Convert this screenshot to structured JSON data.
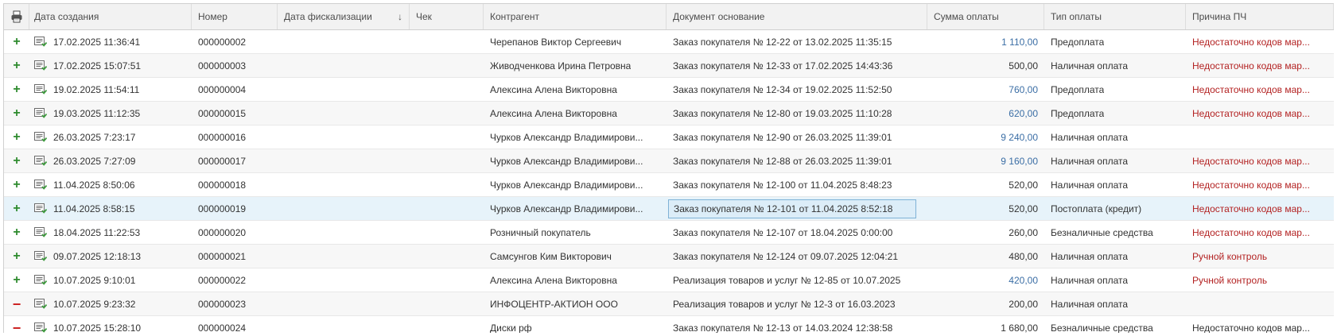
{
  "columns": {
    "icon": "printer-icon",
    "created": "Дата создания",
    "number": "Номер",
    "fiscal_date": "Дата фискализации",
    "fiscal_sort": "↓",
    "receipt": "Чек",
    "counterparty": "Контрагент",
    "basis": "Документ основание",
    "amount": "Сумма оплаты",
    "pay_type": "Тип оплаты",
    "reason": "Причина ПЧ"
  },
  "rows": [
    {
      "sign": "+",
      "created": "17.02.2025 11:36:41",
      "number": "000000002",
      "fiscal_date": "",
      "receipt": "",
      "counterparty": "Черепанов Виктор Сергеевич",
      "basis": "Заказ покупателя № 12-22 от 13.02.2025 11:35:15",
      "amount": "1 110,00",
      "pay_type": "Предоплата",
      "reason": "Недостаточно кодов мар..."
    },
    {
      "sign": "+",
      "created": "17.02.2025 15:07:51",
      "number": "000000003",
      "fiscal_date": "",
      "receipt": "",
      "counterparty": "Живодченкова Ирина Петровна",
      "basis": "Заказ покупателя № 12-33 от 17.02.2025 14:43:36",
      "amount": "500,00",
      "pay_type": "Наличная оплата",
      "reason": "Недостаточно кодов мар..."
    },
    {
      "sign": "+",
      "created": "19.02.2025 11:54:11",
      "number": "000000004",
      "fiscal_date": "",
      "receipt": "",
      "counterparty": "Алексина Алена Викторовна",
      "basis": "Заказ покупателя № 12-34 от 19.02.2025 11:52:50",
      "amount": "760,00",
      "pay_type": "Предоплата",
      "reason": "Недостаточно кодов мар..."
    },
    {
      "sign": "+",
      "created": "19.03.2025 11:12:35",
      "number": "000000015",
      "fiscal_date": "",
      "receipt": "",
      "counterparty": "Алексина Алена Викторовна",
      "basis": "Заказ покупателя № 12-80 от 19.03.2025 11:10:28",
      "amount": "620,00",
      "pay_type": "Предоплата",
      "reason": "Недостаточно кодов мар..."
    },
    {
      "sign": "+",
      "created": "26.03.2025 7:23:17",
      "number": "000000016",
      "fiscal_date": "",
      "receipt": "",
      "counterparty": "Чурков Александр Владимирови...",
      "basis": "Заказ покупателя № 12-90 от 26.03.2025 11:39:01",
      "amount": "9 240,00",
      "pay_type": "Наличная оплата",
      "reason": ""
    },
    {
      "sign": "+",
      "created": "26.03.2025 7:27:09",
      "number": "000000017",
      "fiscal_date": "",
      "receipt": "",
      "counterparty": "Чурков Александр Владимирови...",
      "basis": "Заказ покупателя № 12-88 от 26.03.2025 11:39:01",
      "amount": "9 160,00",
      "pay_type": "Наличная оплата",
      "reason": "Недостаточно кодов мар..."
    },
    {
      "sign": "+",
      "created": "11.04.2025 8:50:06",
      "number": "000000018",
      "fiscal_date": "",
      "receipt": "",
      "counterparty": "Чурков Александр Владимирови...",
      "basis": "Заказ покупателя № 12-100 от 11.04.2025 8:48:23",
      "amount": "520,00",
      "pay_type": "Наличная оплата",
      "reason": "Недостаточно кодов мар..."
    },
    {
      "sign": "+",
      "created": "11.04.2025 8:58:15",
      "number": "000000019",
      "fiscal_date": "",
      "receipt": "",
      "counterparty": "Чурков Александр Владимирови...",
      "basis": "Заказ покупателя № 12-101 от 11.04.2025 8:52:18",
      "amount": "520,00",
      "pay_type": "Постоплата (кредит)",
      "reason": "Недостаточно кодов мар..."
    },
    {
      "sign": "+",
      "created": "18.04.2025 11:22:53",
      "number": "000000020",
      "fiscal_date": "",
      "receipt": "",
      "counterparty": "Розничный покупатель",
      "basis": "Заказ покупателя № 12-107 от 18.04.2025 0:00:00",
      "amount": "260,00",
      "pay_type": "Безналичные средства",
      "reason": "Недостаточно кодов мар..."
    },
    {
      "sign": "+",
      "created": "09.07.2025 12:18:13",
      "number": "000000021",
      "fiscal_date": "",
      "receipt": "",
      "counterparty": "Самсунгов Ким Викторович",
      "basis": "Заказ покупателя № 12-124 от 09.07.2025 12:04:21",
      "amount": "480,00",
      "pay_type": "Наличная оплата",
      "reason": "Ручной контроль"
    },
    {
      "sign": "+",
      "created": "10.07.2025 9:10:01",
      "number": "000000022",
      "fiscal_date": "",
      "receipt": "",
      "counterparty": "Алексина Алена Викторовна",
      "basis": "Реализация товаров и услуг № 12-85 от 10.07.2025",
      "amount": "420,00",
      "pay_type": "Наличная оплата",
      "reason": "Ручной контроль"
    },
    {
      "sign": "−",
      "created": "10.07.2025 9:23:32",
      "number": "000000023",
      "fiscal_date": "",
      "receipt": "",
      "counterparty": "ИНФОЦЕНТР-АКТИОН ООО",
      "basis": "Реализация товаров и услуг № 12-3 от 16.03.2023",
      "amount": "200,00",
      "pay_type": "Наличная оплата",
      "reason": ""
    },
    {
      "sign": "−",
      "created": "10.07.2025 15:28:10",
      "number": "000000024",
      "fiscal_date": "",
      "receipt": "",
      "counterparty": "Диски рф",
      "basis": "Заказ покупателя № 12-13 от 14.03.2024 12:38:58",
      "amount": "1 680,00",
      "pay_type": "Безналичные средства",
      "reason": "Недостаточно кодов мар..."
    }
  ],
  "colors": {
    "link_amount": "#3b6ea5",
    "reason_red": "#b32222",
    "plus_green": "#2e8b2e",
    "minus_red": "#cc2222",
    "selected_row": "#e7f3fa"
  }
}
